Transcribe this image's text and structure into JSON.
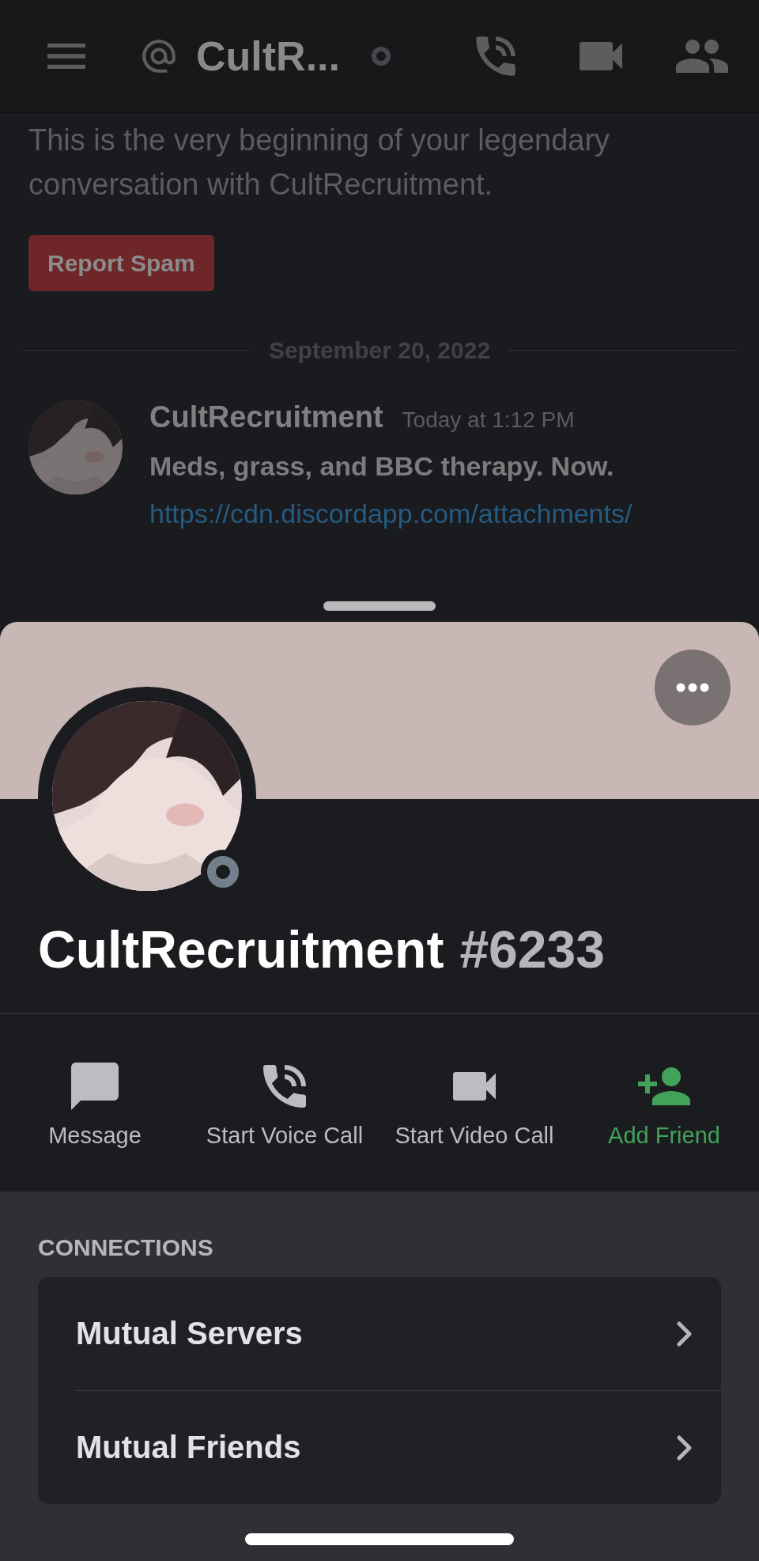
{
  "header": {
    "username": "CultR...",
    "online": false
  },
  "chat": {
    "intro": "This is the very beginning of your legendary conversation with CultRecruitment.",
    "report_button": "Report Spam",
    "date_divider": "September 20, 2022",
    "message": {
      "author": "CultRecruitment",
      "time": "Today at 1:12 PM",
      "text": "Meds, grass, and BBC therapy. Now.",
      "link": "https://cdn.discordapp.com/attachments/"
    }
  },
  "profile": {
    "username": "CultRecruitment",
    "discriminator": "#6233",
    "online": false,
    "actions": [
      {
        "kind": "message",
        "label": "Message"
      },
      {
        "kind": "voice",
        "label": "Start Voice Call"
      },
      {
        "kind": "video",
        "label": "Start Video Call"
      },
      {
        "kind": "add_friend",
        "label": "Add Friend"
      }
    ],
    "connections": {
      "title": "CONNECTIONS",
      "items": [
        "Mutual Servers",
        "Mutual Friends"
      ]
    }
  }
}
